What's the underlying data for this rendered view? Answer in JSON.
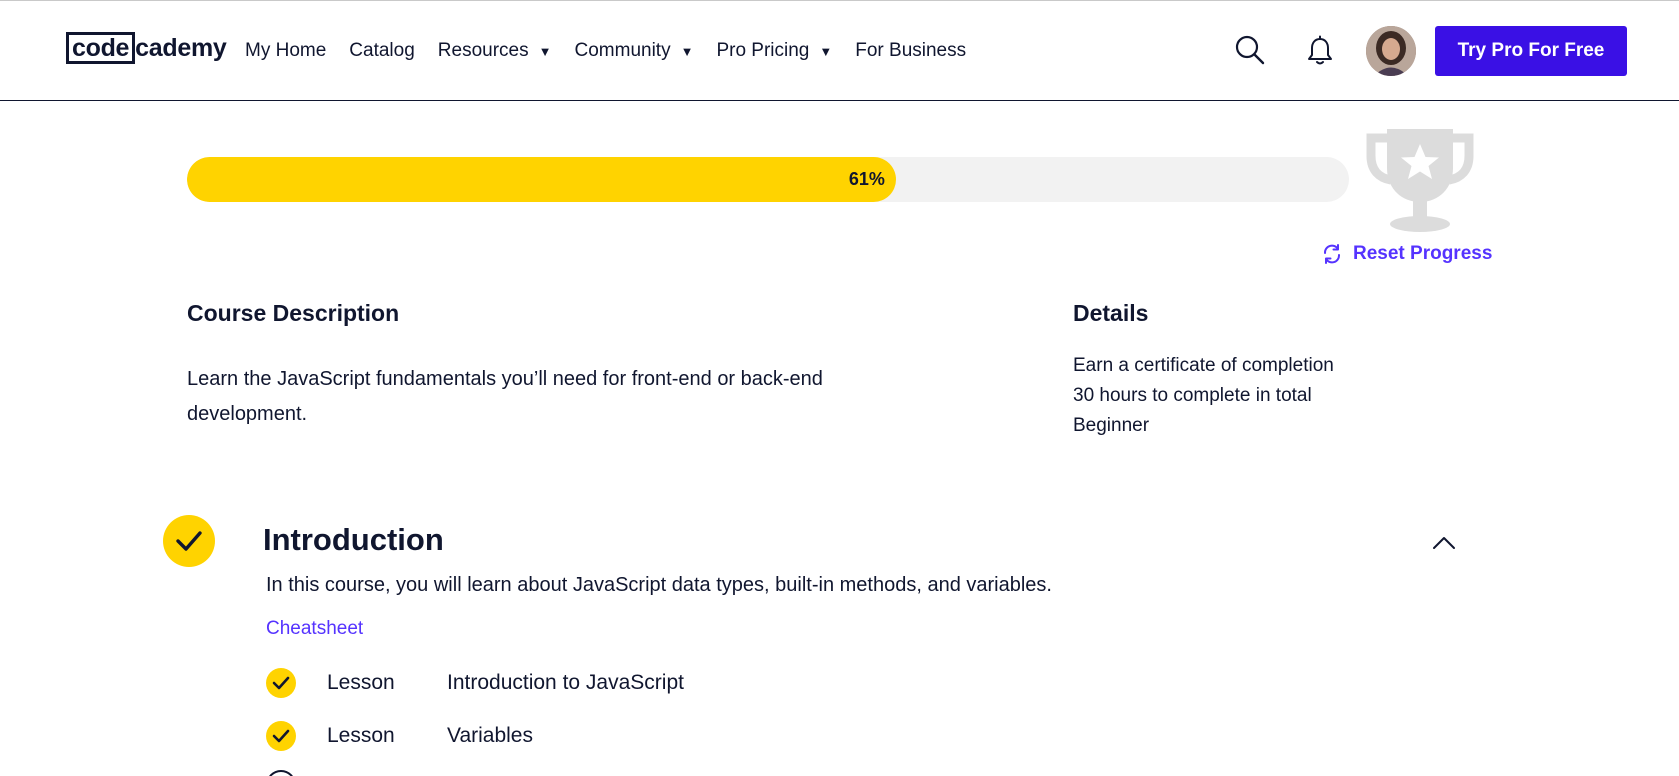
{
  "header": {
    "logo": {
      "boxed": "code",
      "rest": "cademy"
    },
    "nav": [
      {
        "label": "My Home",
        "has_caret": false
      },
      {
        "label": "Catalog",
        "has_caret": false
      },
      {
        "label": "Resources",
        "has_caret": true
      },
      {
        "label": "Community",
        "has_caret": true
      },
      {
        "label": "Pro Pricing",
        "has_caret": true
      },
      {
        "label": "For Business",
        "has_caret": false
      }
    ],
    "caret_glyph": "▼",
    "icons": {
      "search": "search-icon",
      "notifications": "bell-icon",
      "avatar": "user-avatar"
    },
    "cta_label": "Try Pro For Free",
    "cta_color": "#3a10e5"
  },
  "progress": {
    "percent": 61,
    "label": "61%",
    "fill_color": "#ffd300",
    "track_color": "#f2f2f2",
    "trophy_icon": "trophy-icon",
    "reset_label": "Reset Progress",
    "reset_icon": "refresh-icon",
    "reset_color": "#5533ff"
  },
  "course": {
    "description_heading": "Course Description",
    "description": "Learn the JavaScript fundamentals you’ll need for front-end or back-end development.",
    "details_heading": "Details",
    "details": [
      "Earn a certificate of completion",
      "30 hours to complete in total",
      "Beginner"
    ]
  },
  "module": {
    "title": "Introduction",
    "completed": true,
    "expanded": true,
    "description": "In this course, you will learn about JavaScript data types, built-in methods, and variables.",
    "cheatsheet_label": "Cheatsheet",
    "items": [
      {
        "type": "Lesson",
        "name": "Introduction to JavaScript",
        "completed": true
      },
      {
        "type": "Lesson",
        "name": "Variables",
        "completed": true
      }
    ]
  }
}
